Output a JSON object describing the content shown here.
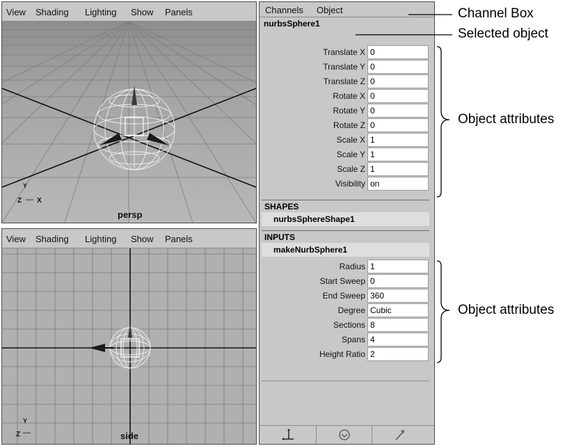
{
  "viewport_menu": [
    "View",
    "Shading",
    "Lighting",
    "Show",
    "Panels"
  ],
  "persp_view": {
    "label": "persp",
    "axis_left": "Z",
    "axis_right": "X",
    "axis_up": "Y"
  },
  "side_view": {
    "label": "side",
    "axis_left": "Z",
    "axis_up": "Y"
  },
  "channel_box": {
    "menu": [
      "Channels",
      "Object"
    ],
    "object_name": "nurbsSphere1",
    "attributes": [
      {
        "label": "Translate X",
        "value": "0"
      },
      {
        "label": "Translate Y",
        "value": "0"
      },
      {
        "label": "Translate Z",
        "value": "0"
      },
      {
        "label": "Rotate X",
        "value": "0"
      },
      {
        "label": "Rotate Y",
        "value": "0"
      },
      {
        "label": "Rotate Z",
        "value": "0"
      },
      {
        "label": "Scale X",
        "value": "1"
      },
      {
        "label": "Scale Y",
        "value": "1"
      },
      {
        "label": "Scale Z",
        "value": "1"
      },
      {
        "label": "Visibility",
        "value": "on"
      }
    ],
    "shapes_header": "SHAPES",
    "shape_node": "nurbsSphereShape1",
    "inputs_header": "INPUTS",
    "input_node": "makeNurbSphere1",
    "input_attributes": [
      {
        "label": "Radius",
        "value": "1"
      },
      {
        "label": "Start Sweep",
        "value": "0"
      },
      {
        "label": "End Sweep",
        "value": "360"
      },
      {
        "label": "Degree",
        "value": "Cubic"
      },
      {
        "label": "Sections",
        "value": "8"
      },
      {
        "label": "Spans",
        "value": "4"
      },
      {
        "label": "Height Ratio",
        "value": "2"
      }
    ],
    "bottom_icons": [
      "move-tool-icon",
      "gauge-icon",
      "arrow-icon"
    ]
  },
  "annotations": {
    "channel_box": "Channel Box",
    "selected_object": "Selected object",
    "object_attributes_1": "Object attributes",
    "object_attributes_2": "Object attributes"
  }
}
